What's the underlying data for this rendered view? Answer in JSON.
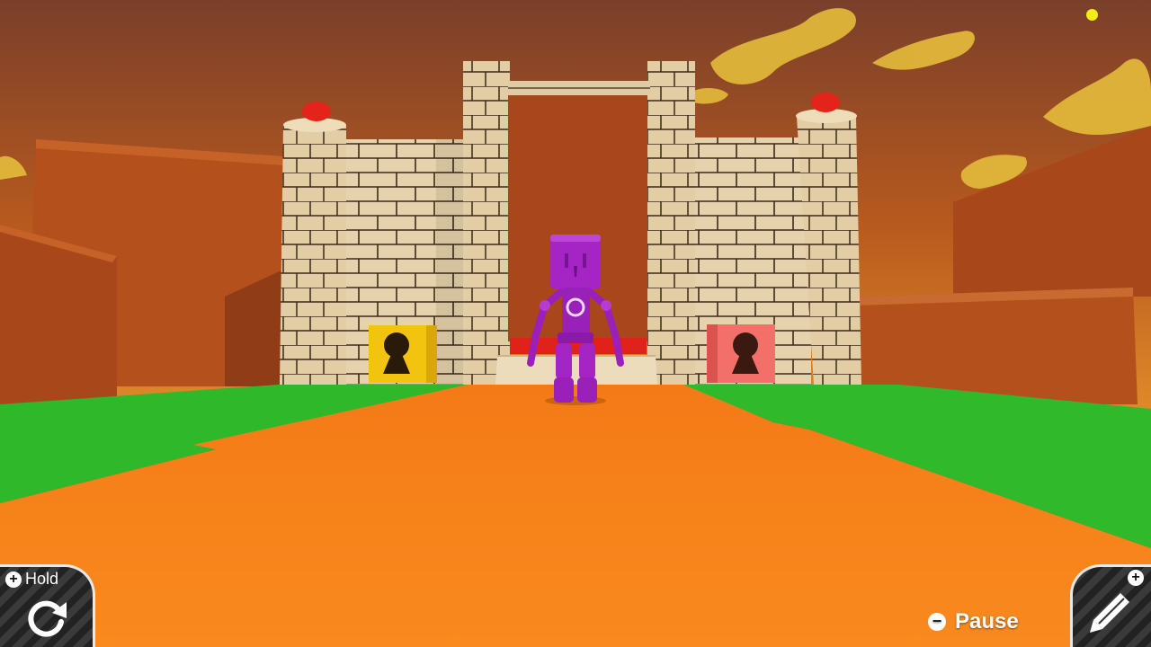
{
  "scene": {
    "colors": {
      "sky_top": "#7a3f2a",
      "sky_mid": "#b85a1e",
      "sky_bottom": "#e08a2a",
      "clouds": "#e0b63a",
      "cliffs": "#b8531c",
      "grass": "#2fb82a",
      "path": "#f77d17",
      "stone": "#e6d2ac",
      "doorway": "#a9461b",
      "lava": "#e0221a",
      "robot": "#a424c4",
      "lock_yellow": "#f2c40f",
      "lock_red": "#f26f6a",
      "button_red": "#e4231a",
      "marker": "#f3ec1a"
    },
    "objects": [
      {
        "name": "castle-gate",
        "icon": "castle"
      },
      {
        "name": "purple-robot",
        "icon": "robot"
      },
      {
        "name": "yellow-keyhole-block",
        "icon": "keyhole"
      },
      {
        "name": "red-keyhole-block",
        "icon": "keyhole"
      }
    ]
  },
  "hud": {
    "hold_label": "Hold",
    "hold_badge": "+",
    "rotate_icon": "rotate-icon",
    "edit_badge": "+",
    "edit_icon": "pencil-icon",
    "pause_badge": "−",
    "pause_label": "Pause"
  }
}
